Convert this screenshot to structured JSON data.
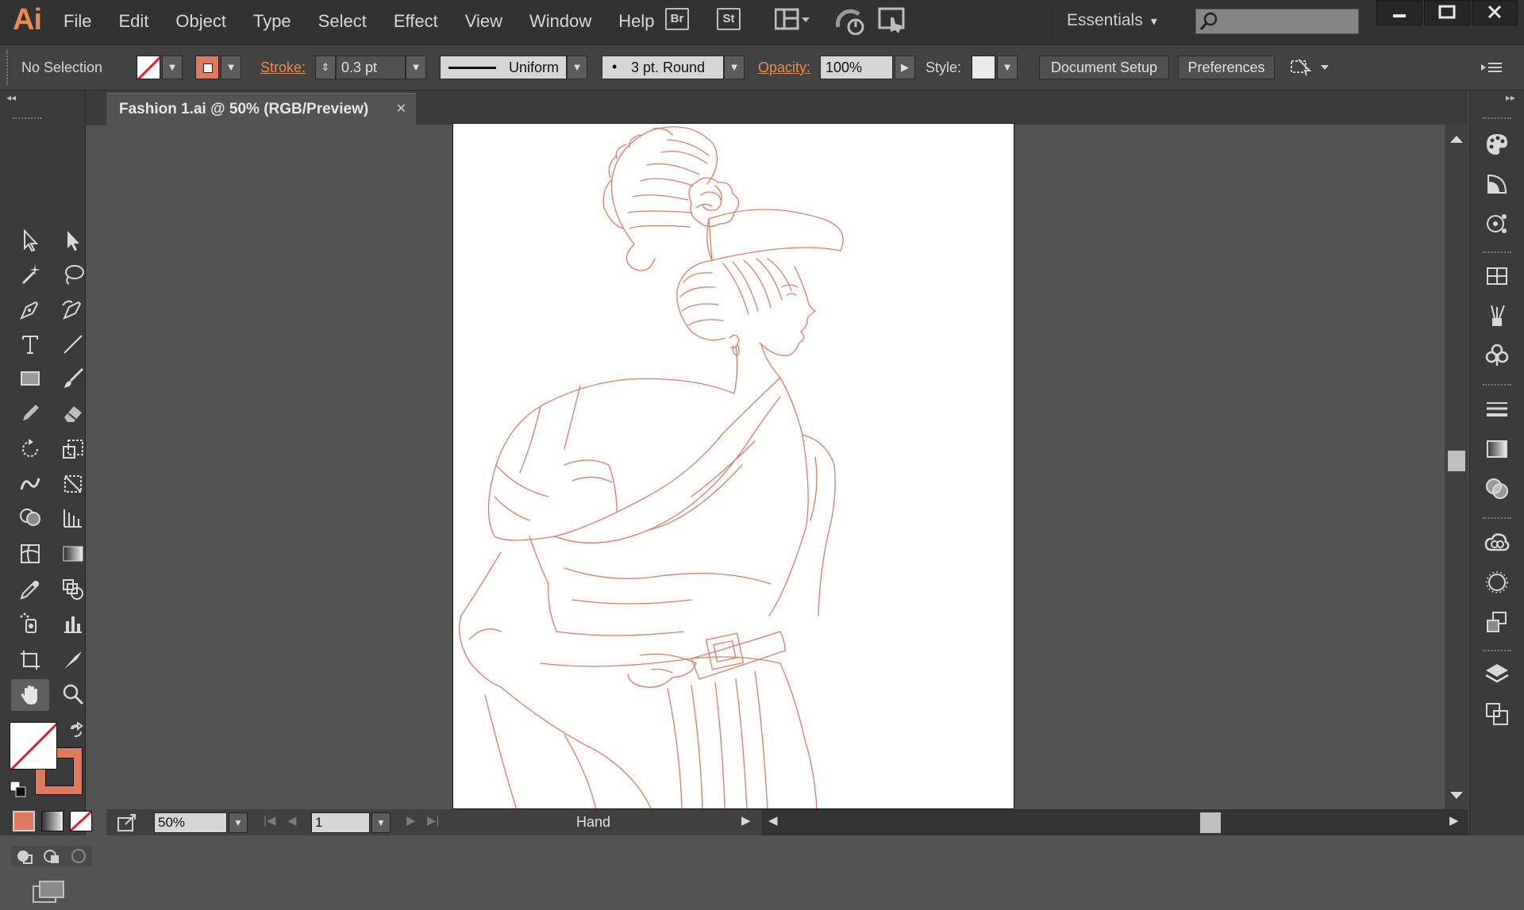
{
  "app": {
    "logo": "Ai",
    "menus": [
      "File",
      "Edit",
      "Object",
      "Type",
      "Select",
      "Effect",
      "View",
      "Window",
      "Help"
    ],
    "bridge_label": "Br",
    "stock_label": "St",
    "workspace": "Essentials"
  },
  "control": {
    "selection": "No Selection",
    "stroke_label": "Stroke:",
    "stroke_weight": "0.3 pt",
    "profile": "Uniform",
    "brush": "3 pt. Round",
    "opacity_label": "Opacity:",
    "opacity_value": "100%",
    "style_label": "Style:",
    "document_setup": "Document Setup",
    "preferences": "Preferences"
  },
  "document": {
    "tab_title": "Fashion 1.ai @ 50% (RGB/Preview)"
  },
  "status": {
    "zoom": "50%",
    "artboard_number": "1",
    "current_tool": "Hand"
  },
  "colors": {
    "accent": "#e88b4e",
    "line_art": "#e07a5f",
    "fill_none": "#ffffff",
    "stroke_swatch": "#e07a5f"
  },
  "tools": [
    "selection",
    "direct-selection",
    "magic-wand",
    "lasso",
    "pen",
    "curvature",
    "type",
    "line",
    "rectangle",
    "paintbrush",
    "pencil",
    "eraser",
    "rotate",
    "scale",
    "warp",
    "free-transform",
    "shape-builder",
    "perspective-grid",
    "mesh",
    "gradient",
    "eyedropper",
    "blend",
    "symbol-sprayer",
    "column-graph",
    "artboard",
    "slice",
    "hand",
    "zoom"
  ],
  "dock_panels": [
    "color",
    "color-guide",
    "cc-libraries",
    "swatches",
    "brushes",
    "symbols",
    "stroke",
    "gradient",
    "transparency",
    "creative-cloud",
    "appearance",
    "graphic-styles",
    "layers",
    "artboards"
  ]
}
